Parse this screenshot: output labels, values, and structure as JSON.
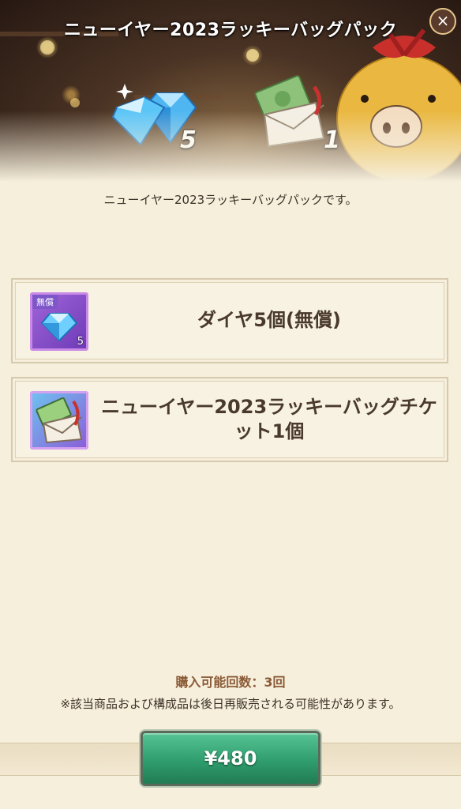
{
  "banner": {
    "title": "ニューイヤー2023ラッキーバッグパック",
    "close_icon": "close-icon",
    "diamond_count": "5",
    "ticket_count": "1"
  },
  "description": "ニューイヤー2023ラッキーバッグパックです。",
  "items": [
    {
      "icon": "diamond-icon",
      "free_tag": "無償",
      "quantity": "5",
      "label": "ダイヤ5個(無償)"
    },
    {
      "icon": "lucky-bag-ticket-icon",
      "label": "ニューイヤー2023ラッキーバッグチケット1個"
    }
  ],
  "purchase_limit": "購入可能回数：3回",
  "notice": "※該当商品および構成品は後日再販売される可能性があります。",
  "buy_button": {
    "price": "¥480"
  },
  "colors": {
    "background": "#f6efdc",
    "button": "#2f9d6d",
    "text": "#4a3a2e"
  }
}
